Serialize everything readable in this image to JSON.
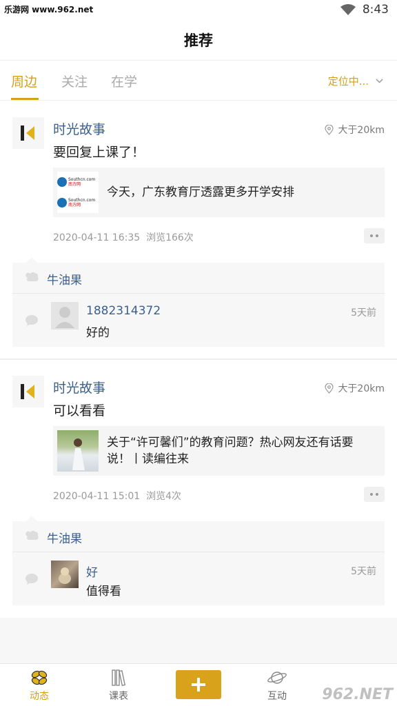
{
  "status_bar": {
    "watermark": "乐游网 www.962.net",
    "time": "8:43"
  },
  "header": {
    "title": "推荐"
  },
  "tabs": [
    {
      "label": "周边",
      "active": true
    },
    {
      "label": "关注",
      "active": false
    },
    {
      "label": "在学",
      "active": false
    }
  ],
  "location": {
    "label": "定位中..."
  },
  "posts": [
    {
      "author": "时光故事",
      "distance": "大于20km",
      "content": "要回复上课了！",
      "link": {
        "text": "今天，广东教育厅透露更多开学安排",
        "thumb_brand": "Southcn.com",
        "thumb_cn": "南方网"
      },
      "date": "2020-04-11 16:35",
      "views": "浏览166次",
      "liker": "牛油果",
      "comment": {
        "name": "1882314372",
        "text": "好的",
        "time": "5天前"
      }
    },
    {
      "author": "时光故事",
      "distance": "大于20km",
      "content": "可以看看",
      "link": {
        "text": "关于“许可馨们”的教育问题？热心网友还有话要说！丨读编往来"
      },
      "date": "2020-04-11 15:01",
      "views": "浏览4次",
      "liker": "牛油果",
      "comment": {
        "name": "好",
        "text": "值得看",
        "time": "5天前"
      }
    }
  ],
  "bottom_nav": [
    {
      "label": "动态",
      "icon": "seed-icon",
      "active": true
    },
    {
      "label": "课表",
      "icon": "books-icon",
      "active": false
    },
    {
      "label": "",
      "icon": "plus-icon",
      "active": false
    },
    {
      "label": "互动",
      "icon": "planet-icon",
      "active": false
    }
  ],
  "watermark_bottom": "962.NET",
  "colors": {
    "accent": "#d4a017",
    "link_blue": "#3a5f8f"
  }
}
